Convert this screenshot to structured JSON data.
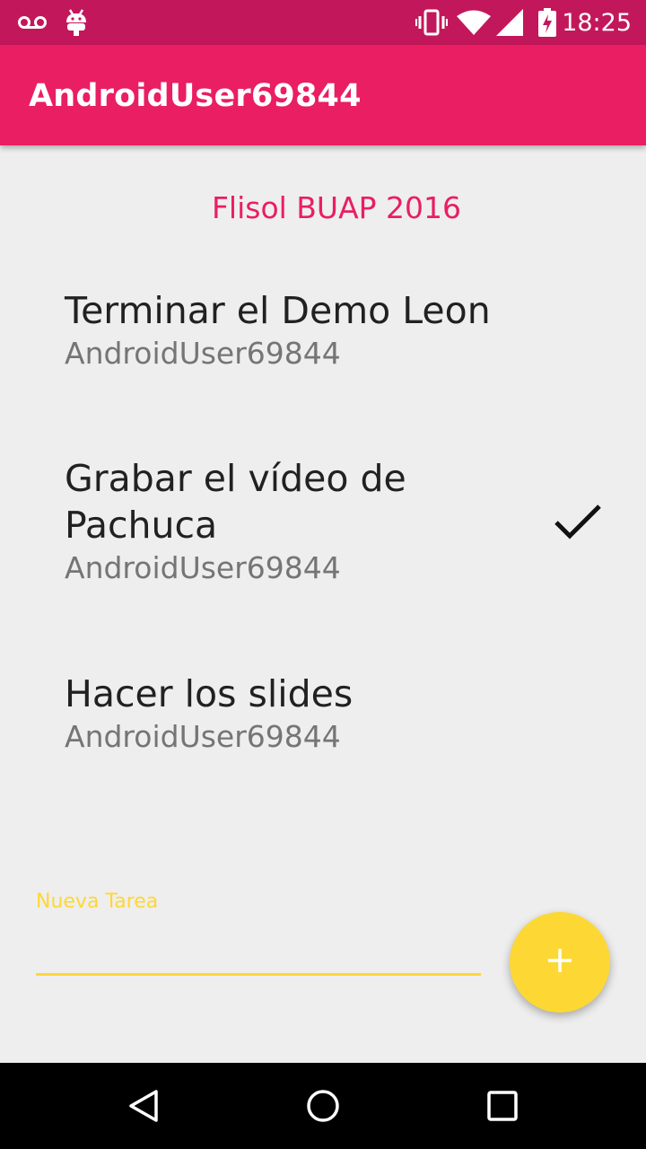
{
  "status_bar": {
    "time": "18:25",
    "icons": [
      "voicemail-icon",
      "android-debug-icon",
      "vibrate-icon",
      "wifi-icon",
      "signal-icon",
      "battery-charging-icon"
    ]
  },
  "app_bar": {
    "title": "AndroidUser69844"
  },
  "list": {
    "header": "Flisol BUAP 2016",
    "tasks": [
      {
        "title": "Terminar el Demo Leon",
        "user": "AndroidUser69844",
        "done": false
      },
      {
        "title": "Grabar el vídeo de Pachuca",
        "user": "AndroidUser69844",
        "done": true
      },
      {
        "title": "Hacer los slides",
        "user": "AndroidUser69844",
        "done": false
      }
    ]
  },
  "new_task": {
    "label": "Nueva Tarea",
    "value": ""
  },
  "colors": {
    "status_bar": "#c2185b",
    "primary": "#e91e63",
    "accent": "#fdd835",
    "background": "#eeeeee"
  },
  "nav_bar": {
    "buttons": [
      "back-icon",
      "home-icon",
      "recents-icon"
    ]
  }
}
